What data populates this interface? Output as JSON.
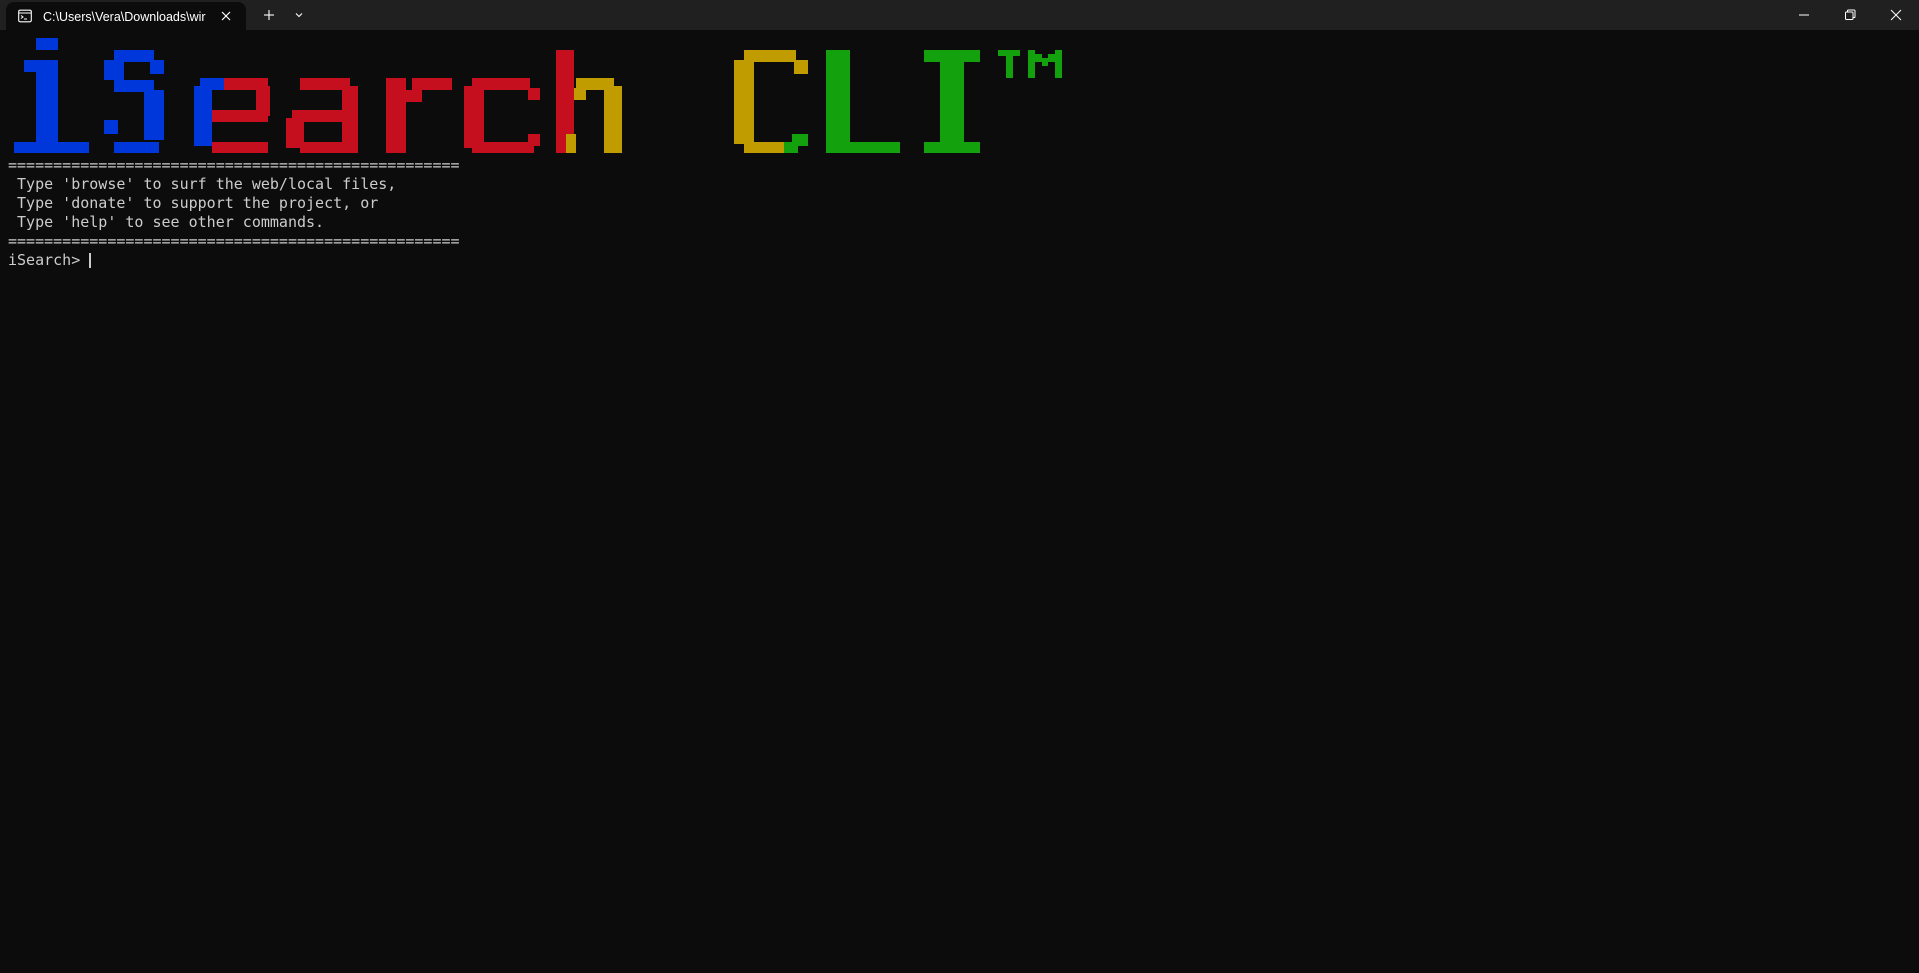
{
  "window": {
    "tab_title": "C:\\Users\\Vera\\Downloads\\wir",
    "tab_icon": "terminal-icon",
    "new_tab_icon": "plus-icon",
    "dropdown_icon": "chevron-down-icon",
    "controls": [
      "minimize-icon",
      "restore-icon",
      "close-icon"
    ]
  },
  "banner": {
    "text": "iSearch CLI™",
    "letters": [
      {
        "char": "i",
        "color": "#0037da"
      },
      {
        "char": "S",
        "color": "#0037da"
      },
      {
        "char": "e",
        "color": "#0037da / #c50f1f"
      },
      {
        "char": "a",
        "color": "#c50f1f"
      },
      {
        "char": "r",
        "color": "#c50f1f"
      },
      {
        "char": "c",
        "color": "#c50f1f"
      },
      {
        "char": "h",
        "color": "#c50f1f / #c19c00"
      },
      {
        "char": "C",
        "color": "#c19c00 / #13a10e"
      },
      {
        "char": "L",
        "color": "#13a10e"
      },
      {
        "char": "I",
        "color": "#13a10e"
      },
      {
        "char": "™",
        "color": "#13a10e"
      }
    ]
  },
  "terminal": {
    "separator_top": "==================================================",
    "lines": [
      " Type 'browse' to surf the web/local files,",
      " Type 'donate' to support the project, or",
      " Type 'help' to see other commands."
    ],
    "separator_bottom": "==================================================",
    "prompt": "iSearch> ",
    "input_value": ""
  },
  "colors": {
    "background": "#0c0c0c",
    "titlebar": "#202020",
    "foreground": "#cccccc",
    "blue": "#0037da",
    "red": "#c50f1f",
    "yellow": "#c19c00",
    "green": "#13a10e"
  }
}
